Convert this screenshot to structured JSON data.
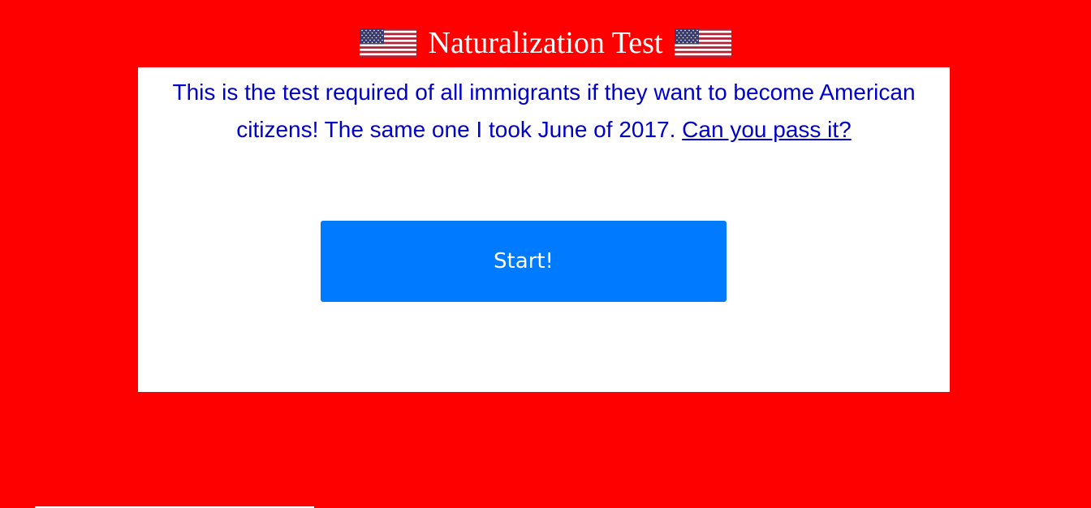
{
  "header": {
    "title": "Naturalization Test",
    "left_icon": "us-flag-icon",
    "right_icon": "us-flag-icon"
  },
  "intro": {
    "text": "This is the test required of all immigrants if they want to become American citizens! The same one I took June of 2017. ",
    "link_text": "Can you pass it?"
  },
  "start_button": {
    "label": "Start!"
  },
  "colors": {
    "background": "#ff0000",
    "card": "#ffffff",
    "text": "#0000cc",
    "button": "#007bff"
  }
}
